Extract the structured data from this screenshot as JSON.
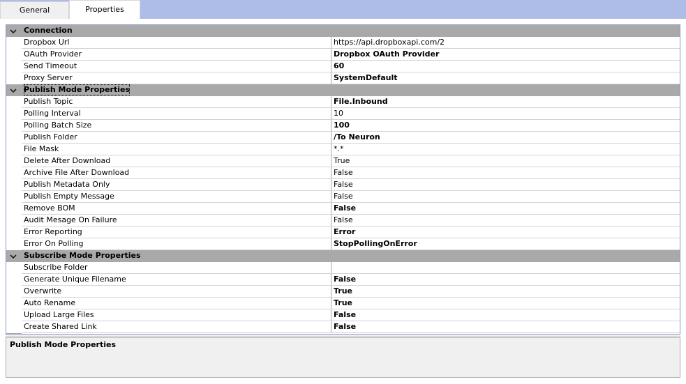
{
  "tabs": {
    "general": "General",
    "properties": "Properties"
  },
  "sections": [
    {
      "title": "Connection",
      "focused": false,
      "props": [
        {
          "name": "Dropbox Url",
          "value": "https://api.dropboxapi.com/2",
          "bold": false
        },
        {
          "name": "OAuth Provider",
          "value": "Dropbox OAuth Provider",
          "bold": true
        },
        {
          "name": "Send Timeout",
          "value": "60",
          "bold": true
        },
        {
          "name": "Proxy Server",
          "value": "SystemDefault",
          "bold": true
        }
      ]
    },
    {
      "title": "Publish Mode Properties",
      "focused": true,
      "props": [
        {
          "name": "Publish Topic",
          "value": "File.Inbound",
          "bold": true
        },
        {
          "name": "Polling Interval",
          "value": "10",
          "bold": false
        },
        {
          "name": "Polling Batch Size",
          "value": "100",
          "bold": true
        },
        {
          "name": "Publish Folder",
          "value": "/To Neuron",
          "bold": true
        },
        {
          "name": "File Mask",
          "value": "*.*",
          "bold": false
        },
        {
          "name": "Delete After Download",
          "value": "True",
          "bold": false
        },
        {
          "name": "Archive File After Download",
          "value": "False",
          "bold": false
        },
        {
          "name": "Publish Metadata Only",
          "value": "False",
          "bold": false
        },
        {
          "name": "Publish Empty Message",
          "value": "False",
          "bold": false
        },
        {
          "name": "Remove BOM",
          "value": "False",
          "bold": true
        },
        {
          "name": "Audit Mesage On Failure",
          "value": "False",
          "bold": false
        },
        {
          "name": "Error Reporting",
          "value": "Error",
          "bold": true
        },
        {
          "name": "Error On Polling",
          "value": "StopPollingOnError",
          "bold": true
        }
      ]
    },
    {
      "title": "Subscribe Mode Properties",
      "focused": false,
      "props": [
        {
          "name": "Subscribe Folder",
          "value": "",
          "bold": false
        },
        {
          "name": "Generate Unique Filename",
          "value": "False",
          "bold": true
        },
        {
          "name": "Overwrite",
          "value": "True",
          "bold": true
        },
        {
          "name": "Auto Rename",
          "value": "True",
          "bold": true
        },
        {
          "name": "Upload Large Files",
          "value": "False",
          "bold": true
        },
        {
          "name": "Create Shared Link",
          "value": "False",
          "bold": true
        }
      ]
    }
  ],
  "help": {
    "title": "Publish Mode Properties"
  },
  "icons": {
    "expander": "chevron-down-icon"
  },
  "colors": {
    "tabstrip": "#aebde8",
    "category": "#a9a9a9",
    "gridBorder": "#8a9ac8"
  }
}
